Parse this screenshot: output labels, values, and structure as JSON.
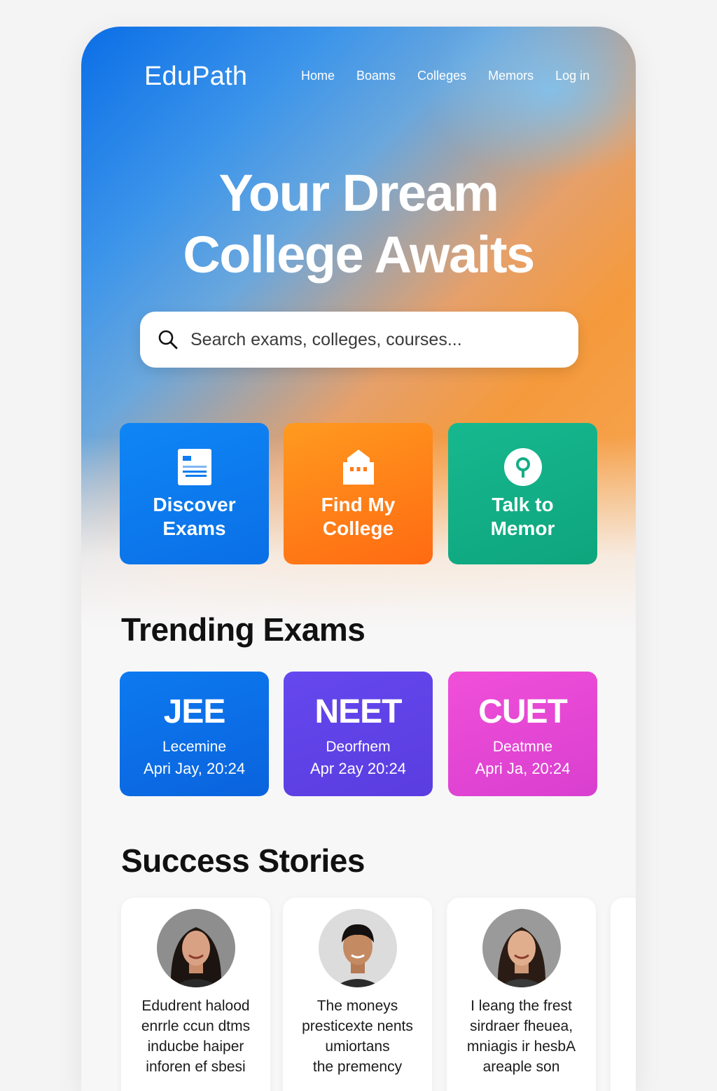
{
  "app": {
    "name": "EduPath"
  },
  "nav": {
    "links": [
      "Home",
      "Boams",
      "Colleges",
      "Memors",
      "Log in"
    ]
  },
  "hero": {
    "headline_line1": "Your Dream",
    "headline_line2": "College Awaits",
    "search_placeholder": "Search exams, colleges, courses..."
  },
  "actions": [
    {
      "line1": "Discover",
      "line2": "Exams",
      "icon": "document-icon",
      "color": "#0d7cf0"
    },
    {
      "line1": "Find My",
      "line2": "College",
      "icon": "building-icon",
      "color": "#ff7a18"
    },
    {
      "line1": "Talk to",
      "line2": "Memor",
      "icon": "location-pin-icon",
      "color": "#14ae86"
    }
  ],
  "trending": {
    "title": "Trending Exams",
    "exams": [
      {
        "name": "JEE",
        "sub": "Lecemine",
        "date": "Apri Jay, 20:24"
      },
      {
        "name": "NEET",
        "sub": "Deorfnem",
        "date": "Apr 2ay 20:24"
      },
      {
        "name": "CUET",
        "sub": "Deatmne",
        "date": "Apri Ja, 20:24"
      }
    ]
  },
  "stories": {
    "title": "Success Stories",
    "items": [
      {
        "lines": [
          "Edudrent halood",
          "enrrle ccun dtms",
          "inducbe haiper",
          "inforen ef sbesi"
        ]
      },
      {
        "lines": [
          "The moneys",
          "presticexte nents",
          "umiortans",
          "the premency"
        ]
      },
      {
        "lines": [
          "I leang the frest",
          "sirdraer fheuea,",
          "mniagis ir hesbA",
          "areaple son"
        ]
      }
    ]
  }
}
